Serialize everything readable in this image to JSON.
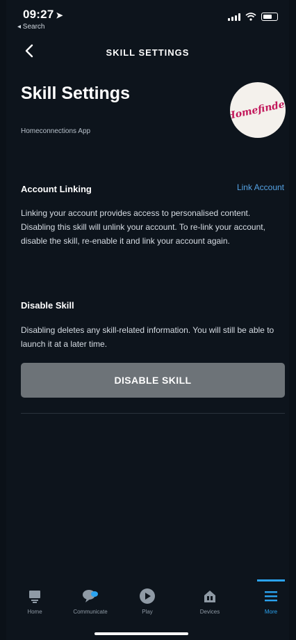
{
  "status_bar": {
    "time": "09:27",
    "back_app": "◂ Search"
  },
  "navbar": {
    "title": "SKILL SETTINGS"
  },
  "header": {
    "title": "Skill Settings",
    "subtitle": "Homeconnections App",
    "logo_text": "Homefinder"
  },
  "account_linking": {
    "title": "Account Linking",
    "link_label": "Link Account",
    "description": "Linking your account provides access to personalised content. Disabling this skill will unlink your account. To re-link your account, disable the skill, re-enable it and link your account again."
  },
  "disable_skill": {
    "title": "Disable Skill",
    "description": "Disabling deletes any skill-related information. You will still be able to launch it at a later time.",
    "button_label": "DISABLE SKILL"
  },
  "tabbar": {
    "items": [
      {
        "label": "Home",
        "icon": "home-icon"
      },
      {
        "label": "Communicate",
        "icon": "chat-bubble-icon"
      },
      {
        "label": "Play",
        "icon": "play-icon"
      },
      {
        "label": "Devices",
        "icon": "devices-icon"
      },
      {
        "label": "More",
        "icon": "menu-icon"
      }
    ],
    "active": "More"
  },
  "colors": {
    "background": "#0d141c",
    "accent": "#2ba3f0",
    "link": "#56a4e6",
    "button": "#6d7378"
  }
}
